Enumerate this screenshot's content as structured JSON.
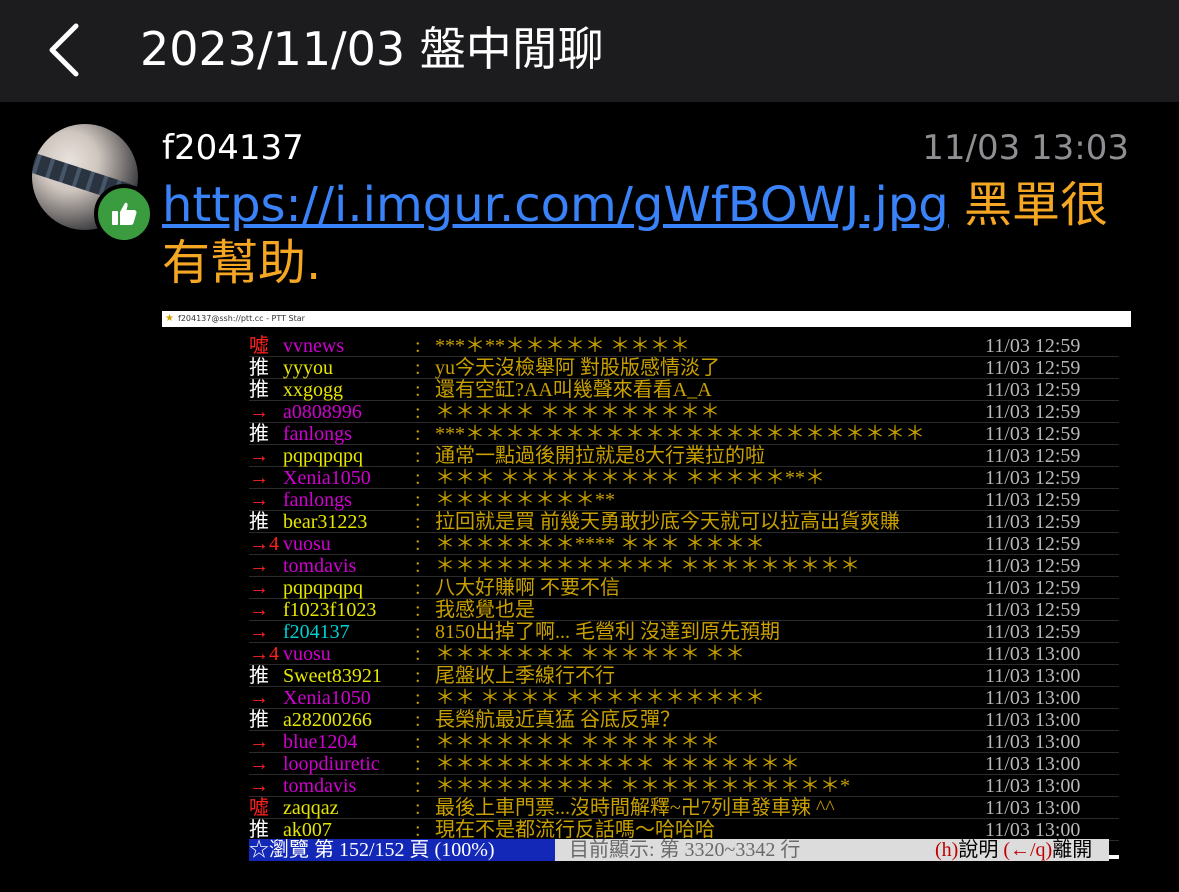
{
  "header": {
    "title": "2023/11/03 盤中閒聊"
  },
  "post": {
    "username": "f204137",
    "time": "11/03 13:03",
    "link": "https://i.imgur.com/gWfBOWJ.jpg",
    "text": "黑單很有幫助."
  },
  "screenshot": {
    "window_title": "f204137@ssh://ptt.cc - PTT Star",
    "rows": [
      {
        "tag": "噓",
        "kind": "boo",
        "user": "vvnews",
        "ucls": "c-mag",
        "content": "***＊**＊＊＊＊＊ ＊＊＊＊",
        "time": "11/03 12:59"
      },
      {
        "tag": "推",
        "kind": "push",
        "user": "yyyou",
        "ucls": "c-yel",
        "content": "yu今天沒檢舉阿   對股版感情淡了",
        "time": "11/03 12:59"
      },
      {
        "tag": "推",
        "kind": "push",
        "user": "xxgogg",
        "ucls": "c-yel",
        "content": "還有空缸?AA叫幾聲來看看A_A",
        "time": "11/03 12:59"
      },
      {
        "tag": "→",
        "kind": "arrow",
        "user": "a0808996",
        "ucls": "c-mag",
        "content": "＊＊＊＊＊ ＊＊＊＊＊＊＊＊＊",
        "time": "11/03 12:59"
      },
      {
        "tag": "推",
        "kind": "push",
        "user": "fanlongs",
        "ucls": "c-mag",
        "content": "***＊＊＊＊＊＊＊＊＊＊＊＊＊＊＊＊＊＊＊＊＊＊＊",
        "time": "11/03 12:59"
      },
      {
        "tag": "→",
        "kind": "arrow",
        "user": "pqpqpqpq",
        "ucls": "c-yel",
        "content": "通常一點過後開拉就是8大行業拉的啦",
        "time": "11/03 12:59"
      },
      {
        "tag": "→",
        "kind": "arrow",
        "user": "Xenia1050",
        "ucls": "c-mag",
        "content": "＊＊＊ ＊＊＊＊＊＊＊＊＊ ＊＊＊＊＊**＊",
        "time": "11/03 12:59"
      },
      {
        "tag": "→",
        "kind": "arrow",
        "user": "fanlongs",
        "ucls": "c-mag",
        "content": "＊＊＊＊＊＊＊＊**",
        "time": "11/03 12:59"
      },
      {
        "tag": "推",
        "kind": "push",
        "user": "bear31223",
        "ucls": "c-yel",
        "content": "拉回就是買 前幾天勇敢抄底今天就可以拉高出貨爽賺",
        "time": "11/03 12:59"
      },
      {
        "tag": "→4",
        "kind": "arrow",
        "user": "vuosu",
        "ucls": "c-mag",
        "content": "＊＊＊＊＊＊＊**** ＊＊＊ ＊＊＊＊",
        "time": "11/03 12:59"
      },
      {
        "tag": "→",
        "kind": "arrow",
        "user": "tomdavis",
        "ucls": "c-mag",
        "content": "＊＊＊＊＊＊＊＊＊＊＊＊ ＊＊＊＊＊＊＊＊＊",
        "time": "11/03 12:59"
      },
      {
        "tag": "→",
        "kind": "arrow",
        "user": "pqpqpqpq",
        "ucls": "c-yel",
        "content": "八大好賺啊 不要不信",
        "time": "11/03 12:59"
      },
      {
        "tag": "→",
        "kind": "arrow",
        "user": "f1023f1023",
        "ucls": "c-yel",
        "content": "我感覺也是",
        "time": "11/03 12:59"
      },
      {
        "tag": "→",
        "kind": "arrow",
        "user": "f204137",
        "ucls": "c-cyan",
        "content": "8150出掉了啊... 毛營利 沒達到原先預期",
        "time": "11/03 12:59"
      },
      {
        "tag": "→4",
        "kind": "arrow",
        "user": "vuosu",
        "ucls": "c-mag",
        "content": "＊＊＊＊＊＊＊ ＊＊＊＊＊＊ ＊＊",
        "time": "11/03 13:00"
      },
      {
        "tag": "推",
        "kind": "push",
        "user": "Sweet83921",
        "ucls": "c-yel",
        "content": "尾盤收上季線行不行",
        "time": "11/03 13:00"
      },
      {
        "tag": "→",
        "kind": "arrow",
        "user": "Xenia1050",
        "ucls": "c-mag",
        "content": "＊＊ ＊＊＊＊ ＊＊＊＊＊＊＊＊＊＊",
        "time": "11/03 13:00"
      },
      {
        "tag": "推",
        "kind": "push",
        "user": "a28200266",
        "ucls": "c-yel",
        "content": "長榮航最近真猛 谷底反彈？",
        "time": "11/03 13:00"
      },
      {
        "tag": "→",
        "kind": "arrow",
        "user": "blue1204",
        "ucls": "c-mag",
        "content": "＊＊＊＊＊＊＊ ＊＊＊＊＊＊＊",
        "time": "11/03 13:00"
      },
      {
        "tag": "→",
        "kind": "arrow",
        "user": "loopdiuretic",
        "ucls": "c-mag",
        "content": "＊＊＊＊＊＊＊＊＊＊＊ ＊＊＊＊＊＊＊",
        "time": "11/03 13:00"
      },
      {
        "tag": "→",
        "kind": "arrow",
        "user": "tomdavis",
        "ucls": "c-mag",
        "content": "＊＊＊＊＊＊＊＊＊ ＊＊＊＊＊＊＊＊＊＊＊*",
        "time": "11/03 13:00"
      },
      {
        "tag": "噓",
        "kind": "boo",
        "user": "zaqqaz",
        "ucls": "c-yel",
        "content": "最後上車門票...沒時間解釋~卍7列車發車辣 ^^",
        "time": "11/03 13:00"
      },
      {
        "tag": "推",
        "kind": "push",
        "user": "ak007",
        "ucls": "c-yel",
        "content": "現在不是都流行反話嗎～哈哈哈",
        "time": "11/03 13:00"
      }
    ],
    "status": {
      "left": "☆瀏覽 第 152/152 頁 (100%)",
      "middle": "目前顯示: 第 3320~3342 行",
      "help_key": "(h)",
      "help_label": "說明",
      "leave_key": "(←/q)",
      "leave_label": "離開"
    }
  }
}
